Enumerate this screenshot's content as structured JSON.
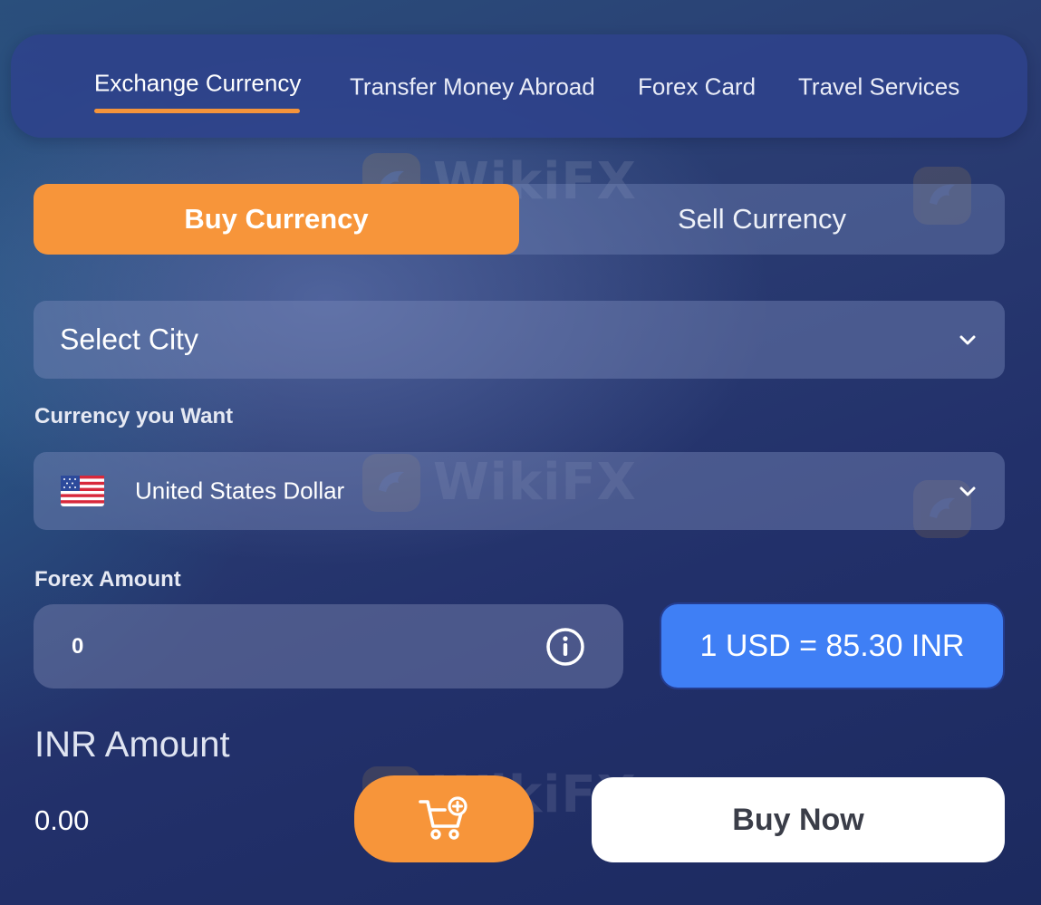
{
  "tabs": [
    {
      "label": "Exchange Currency",
      "active": true
    },
    {
      "label": "Transfer Money Abroad",
      "active": false
    },
    {
      "label": "Forex Card",
      "active": false
    },
    {
      "label": "Travel Services",
      "active": false
    }
  ],
  "toggle": {
    "buy_label": "Buy Currency",
    "sell_label": "Sell Currency",
    "selected": "buy"
  },
  "city_select": {
    "value": "Select City"
  },
  "currency": {
    "label": "Currency you Want",
    "selected": "United States Dollar",
    "flag_icon": "us-flag-icon"
  },
  "forex_amount": {
    "label": "Forex Amount",
    "value": "0"
  },
  "rate": {
    "text": "1 USD = 85.30 INR"
  },
  "inr_amount": {
    "label": "INR Amount",
    "value": "0.00"
  },
  "actions": {
    "cart_icon": "add-to-cart-icon",
    "buy_now_label": "Buy Now"
  },
  "watermark": {
    "text": "WikiFX"
  },
  "colors": {
    "accent_orange": "#f7953a",
    "rate_blue": "#3f7ff5",
    "button_white": "#ffffff"
  }
}
